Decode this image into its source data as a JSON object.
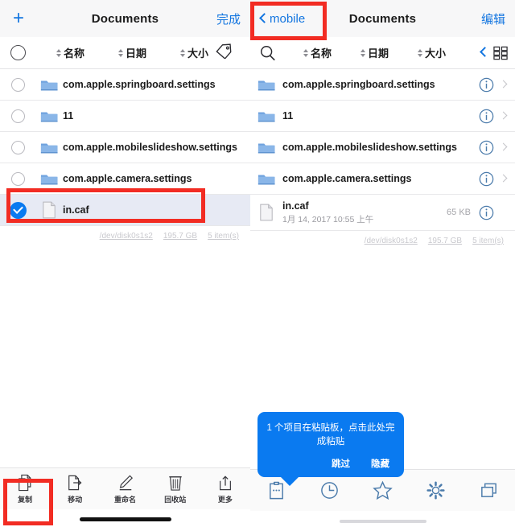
{
  "left_pane": {
    "navbar": {
      "add_icon": "plus-icon",
      "title": "Documents",
      "done_label": "完成"
    },
    "sortbar": {
      "select_all_icon": "circle-select-icon",
      "columns": [
        {
          "label": "名称"
        },
        {
          "label": "日期"
        },
        {
          "label": "大小"
        }
      ],
      "tag_icon": "tag-icon"
    },
    "rows": [
      {
        "name": "com.apple.springboard.settings",
        "icon": "folder-icon",
        "selected": false
      },
      {
        "name": "11",
        "icon": "folder-icon",
        "selected": false
      },
      {
        "name": "com.apple.mobileslideshow.settings",
        "icon": "folder-icon",
        "selected": false
      },
      {
        "name": "com.apple.camera.settings",
        "icon": "folder-icon",
        "selected": false
      },
      {
        "name": "in.caf",
        "icon": "document-icon",
        "selected": true
      }
    ],
    "disk_status": {
      "device": "/dev/disk0s1s2",
      "capacity": "195.7 GB",
      "items": "5 item(s)"
    },
    "toolbar": [
      {
        "label": "复制",
        "icon": "copy-icon"
      },
      {
        "label": "移动",
        "icon": "move-icon"
      },
      {
        "label": "重命名",
        "icon": "rename-icon"
      },
      {
        "label": "回收站",
        "icon": "trash-icon"
      },
      {
        "label": "更多",
        "icon": "more-share-icon"
      }
    ]
  },
  "right_pane": {
    "navbar": {
      "back_label": "mobile",
      "back_icon": "chevron-left-icon",
      "title": "Documents",
      "edit_label": "编辑"
    },
    "sortbar": {
      "search_icon": "search-icon",
      "columns": [
        {
          "label": "名称"
        },
        {
          "label": "日期"
        },
        {
          "label": "大小"
        }
      ],
      "collapse_icon": "chevron-left-icon",
      "grid_icon": "grid-view-icon"
    },
    "rows": [
      {
        "name": "com.apple.springboard.settings",
        "icon": "folder-icon",
        "detail": "",
        "size": "",
        "info_icon": "info-icon",
        "chevron": "chevron-right-icon"
      },
      {
        "name": "11",
        "icon": "folder-icon",
        "detail": "",
        "size": "",
        "info_icon": "info-icon",
        "chevron": "chevron-right-icon"
      },
      {
        "name": "com.apple.mobileslideshow.settings",
        "icon": "folder-icon",
        "detail": "",
        "size": "",
        "info_icon": "info-icon",
        "chevron": "chevron-right-icon"
      },
      {
        "name": "com.apple.camera.settings",
        "icon": "folder-icon",
        "detail": "",
        "size": "",
        "info_icon": "info-icon",
        "chevron": "chevron-right-icon"
      },
      {
        "name": "in.caf",
        "icon": "document-icon",
        "detail": "1月 14, 2017 10:55 上午",
        "size": "65 KB",
        "info_icon": "info-icon",
        "chevron": ""
      }
    ],
    "disk_status": {
      "device": "/dev/disk0s1s2",
      "capacity": "195.7 GB",
      "items": "5 item(s)"
    },
    "popup": {
      "message": "1 个项目在粘贴板，点击此处完成粘贴",
      "skip_label": "跳过",
      "hide_label": "隐藏",
      "background": "#0a7af0"
    },
    "tabbar": [
      {
        "icon": "clipboard-icon"
      },
      {
        "icon": "clock-recent-icon"
      },
      {
        "icon": "star-favorites-icon"
      },
      {
        "icon": "gear-settings-icon"
      },
      {
        "icon": "windows-tabs-icon"
      }
    ]
  },
  "annotations": {
    "accent_red": "#f22c23",
    "accent_blue": "#1476e0",
    "selected_row_bg": "#e7eaf4"
  }
}
